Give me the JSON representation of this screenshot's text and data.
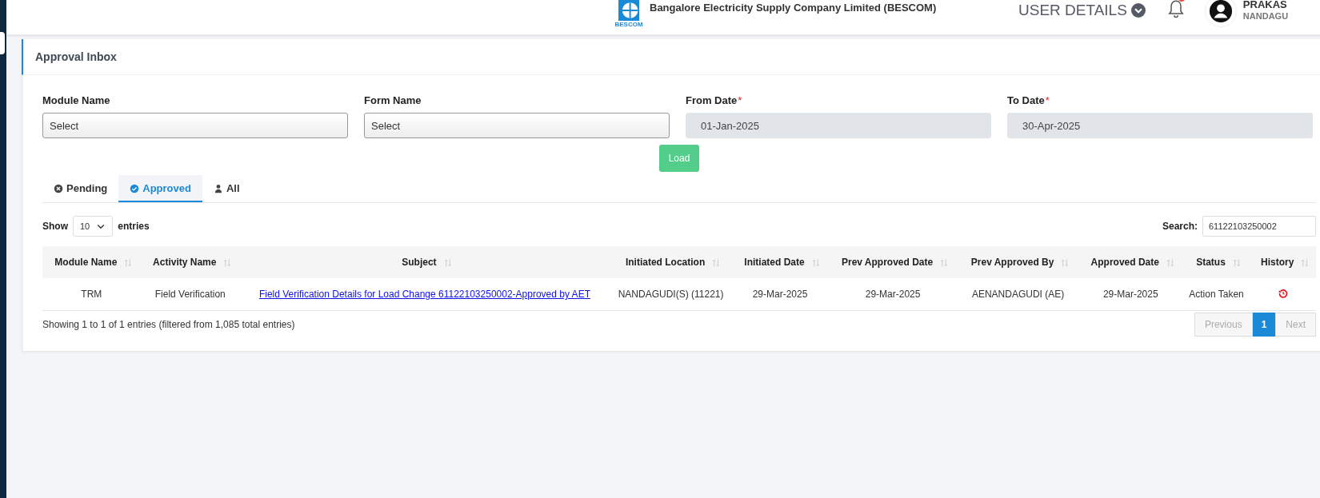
{
  "header": {
    "logo_text": "BESCOM",
    "company": "Bangalore Electricity Supply Company Limited (BESCOM)",
    "user_details": "USER DETAILS",
    "user_name": "PRAKAS",
    "user_location": "NANDAGU"
  },
  "panel": {
    "title": "Approval Inbox"
  },
  "filters": [
    {
      "kind": "select",
      "label": "Module Name",
      "value": "Select"
    },
    {
      "kind": "select",
      "label": "Form Name",
      "value": "Select"
    },
    {
      "kind": "date",
      "label": "From Date",
      "required_mark": "*",
      "value": "01-Jan-2025"
    },
    {
      "kind": "date",
      "label": "To Date",
      "required_mark": "*",
      "value": "30-Apr-2025"
    }
  ],
  "load_button": "Load",
  "tabs": [
    {
      "label": "Pending",
      "selected": false
    },
    {
      "label": "Approved",
      "selected": true
    },
    {
      "label": "All",
      "selected": false
    }
  ],
  "length": {
    "prefix": "Show",
    "value": "10",
    "suffix": "entries"
  },
  "search": {
    "label": "Search:",
    "value": "61122103250002"
  },
  "table": {
    "columns": [
      "Module Name",
      "Activity Name",
      "Subject",
      "Initiated Location",
      "Initiated Date",
      "Prev Approved Date",
      "Prev Approved By",
      "Approved Date",
      "Status",
      "History"
    ],
    "rows": [
      {
        "module": "TRM",
        "activity": "Field Verification",
        "subject": "Field Verification Details for Load Change 61122103250002-Approved by AET",
        "location": "NANDAGUDI(S) (11221)",
        "initiated_date": "29-Mar-2025",
        "prev_approved_date": "29-Mar-2025",
        "prev_approved_by": "AENANDAGUDI (AE)",
        "approved_date": "29-Mar-2025",
        "status": "Action Taken"
      }
    ]
  },
  "info": "Showing 1 to 1 of 1 entries (filtered from 1,085 total entries)",
  "pagination": [
    {
      "label": "Previous",
      "disabled": true,
      "selected": false
    },
    {
      "label": "1",
      "disabled": false,
      "selected": true
    },
    {
      "label": "Next",
      "disabled": true,
      "selected": false
    }
  ]
}
